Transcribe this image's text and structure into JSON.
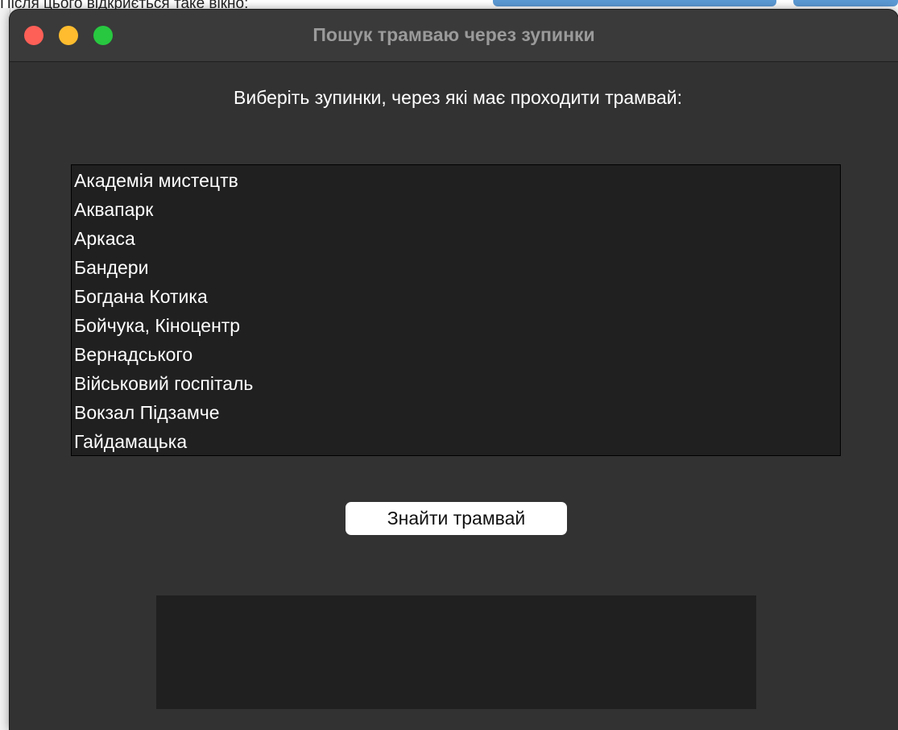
{
  "background": {
    "caption": "Після цього відкриється таке вікно:"
  },
  "window": {
    "title": "Пошук трамваю через зупинки",
    "prompt": "Виберіть зупинки, через які має проходити трамвай:",
    "stops": [
      "Академія мистецтв",
      "Аквапарк",
      "Аркаса",
      "Бандери",
      "Богдана Котика",
      "Бойчука, Кіноцентр",
      "Вернадського",
      "Військовий госпіталь",
      "Вокзал Підзамче",
      "Гайдамацька"
    ],
    "find_button_label": "Знайти трамвай",
    "result_text": ""
  },
  "colors": {
    "window_bg": "#323232",
    "list_bg": "#202020",
    "traffic_close": "#fe5f57",
    "traffic_minimize": "#febc2e",
    "traffic_zoom": "#28c840"
  }
}
